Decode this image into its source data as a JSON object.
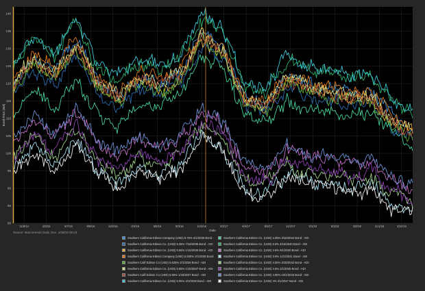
{
  "chart_data": {
    "type": "line",
    "title": "",
    "xlabel": "Date",
    "ylabel": "Bond Price (Bid)",
    "ylim": [
      80,
      142
    ],
    "yticks": [
      80,
      85,
      90,
      95,
      100,
      105,
      110,
      115,
      120,
      125,
      130,
      135,
      140
    ],
    "x_tick_labels": [
      "11/6/14",
      "2/3/15",
      "5/7/15",
      "8/6/15",
      "11/5/15",
      "2/4/16",
      "5/5/16",
      "8/4/16",
      "11/3/16",
      "2/2/17",
      "5/4/17",
      "8/3/17",
      "11/2/17",
      "2/1/18",
      "5/3/18",
      "8/2/18",
      "11/1/18",
      "1/31/19"
    ],
    "grid": true,
    "legend_position": "bottom",
    "source": "Source: Macrotrends Daily. Dec. 4/28/19 09:23",
    "series": [
      {
        "name": "Southern California Edison Company (USD) 5.75% 4/1/2035 Bond - ADI",
        "color": "#3d8fd6",
        "values": [
          120,
          128,
          124,
          133,
          121,
          117,
          121,
          119,
          123,
          135,
          130,
          116,
          114,
          122,
          120,
          118,
          118,
          118,
          111,
          106
        ]
      },
      {
        "name": "Southern California Edison Co. (USD) 4.05% 3/15/2042 Bond - ADI",
        "color": "#46d49a",
        "values": [
          111,
          118,
          112,
          121,
          112,
          108,
          114,
          113,
          118,
          128,
          124,
          111,
          109,
          116,
          113,
          112,
          111,
          112,
          106,
          102
        ]
      },
      {
        "name": "Southern California Edison Co. (USD) 5.35% 7/15/2035 Bond - ADI",
        "color": "#2a6bb0",
        "values": [
          117,
          124,
          119,
          128,
          117,
          113,
          118,
          116,
          121,
          131,
          127,
          114,
          112,
          119,
          117,
          115,
          114,
          115,
          108,
          104
        ]
      },
      {
        "name": "Southern California Edison Co. (USD) 5.5% 3/15/2040 Bond - ADI",
        "color": "#2fb26b",
        "values": [
          124,
          133,
          128,
          138,
          124,
          121,
          126,
          124,
          128,
          138,
          135,
          119,
          117,
          127,
          124,
          123,
          122,
          122,
          115,
          111
        ]
      },
      {
        "name": "Southern California Edison Co. (USD) 5.55% 1/15/2036 Bond - ADI",
        "color": "#e8b13a",
        "values": [
          119,
          127,
          122,
          131,
          120,
          116,
          121,
          118,
          122,
          133,
          129,
          115,
          113,
          121,
          119,
          117,
          116,
          116,
          109,
          105
        ]
      },
      {
        "name": "Southern California Edison Co. (USD) 4.5% 9/1/2040 Bond - ADI",
        "color": "#c070c8",
        "values": [
          103,
          110,
          104,
          112,
          103,
          99,
          104,
          101,
          104,
          112,
          108,
          96,
          94,
          101,
          99,
          98,
          97,
          98,
          92,
          90
        ]
      },
      {
        "name": "Southern California Edison Company (USD) 5.625% 2/1/2036 Bond - ADI",
        "color": "#e07b1a",
        "values": [
          121,
          129,
          124,
          133,
          122,
          118,
          123,
          121,
          125,
          135,
          131,
          117,
          115,
          123,
          121,
          119,
          118,
          118,
          111,
          107
        ]
      },
      {
        "name": "Southern California Edison Co. (USD) 3.9% 12/1/2041 Bond - ADI",
        "color": "#a9e0f0",
        "values": [
          95,
          102,
          96,
          104,
          95,
          91,
          96,
          94,
          97,
          105,
          101,
          89,
          88,
          94,
          92,
          91,
          90,
          91,
          85,
          84
        ]
      },
      {
        "name": "Southern Calif Edison Co (USD) 5.625% 2/1/2036 Bond - ADI",
        "color": "#5fae3b",
        "values": [
          118,
          126,
          121,
          130,
          119,
          115,
          120,
          117,
          121,
          132,
          128,
          114,
          112,
          120,
          118,
          116,
          115,
          115,
          108,
          105
        ]
      },
      {
        "name": "Southern California Edison Co. (USD) 4.05% 3/15/2042 Bond - ADI",
        "color": "#9fd08a",
        "values": [
          98,
          105,
          99,
          107,
          98,
          94,
          99,
          97,
          100,
          108,
          104,
          92,
          91,
          97,
          95,
          94,
          93,
          94,
          88,
          86
        ]
      },
      {
        "name": "Southern California Edison Co. (USD) 5.55% 1/15/2037 Bond - ADI",
        "color": "#d2dd8a",
        "values": [
          120,
          128,
          123,
          132,
          121,
          117,
          122,
          120,
          124,
          134,
          130,
          116,
          114,
          122,
          120,
          118,
          117,
          117,
          110,
          106
        ]
      },
      {
        "name": "Southern California Edison Co. (USD) 3.6% 2/1/2045 Bond - ADI",
        "color": "#8a3fae",
        "values": [
          99,
          106,
          100,
          108,
          99,
          95,
          100,
          98,
          101,
          109,
          105,
          93,
          92,
          98,
          96,
          95,
          94,
          95,
          89,
          87
        ]
      },
      {
        "name": "Southern Calif Edison Co (USD) 5.55% 1/15/2037 Bond - ADI",
        "color": "#a54a3a",
        "values": [
          119,
          127,
          122,
          131,
          120,
          116,
          121,
          119,
          123,
          133,
          129,
          115,
          113,
          121,
          119,
          117,
          116,
          116,
          109,
          105
        ]
      },
      {
        "name": "Southern California Edison Co. (USD) 4.65% 10/1/2043 Bond - ADI",
        "color": "#6a8fd0",
        "values": [
          104,
          111,
          105,
          113,
          104,
          100,
          105,
          102,
          105,
          113,
          109,
          97,
          95,
          102,
          100,
          99,
          98,
          99,
          93,
          91
        ]
      },
      {
        "name": "Southern California Edison Co. (USD) 5.95% 2/1/2038 Bond - ADI",
        "color": "#3ec7d6",
        "values": [
          125,
          134,
          129,
          139,
          125,
          122,
          127,
          125,
          129,
          140,
          136,
          120,
          118,
          128,
          125,
          124,
          123,
          123,
          116,
          112
        ]
      },
      {
        "name": "Southern California Edison Co. (USD) 4% 4/1/2047 Bond - ADI",
        "color": "#f2f2f2",
        "values": [
          94,
          100,
          95,
          103,
          94,
          90,
          95,
          93,
          96,
          104,
          100,
          88,
          87,
          93,
          91,
          90,
          89,
          90,
          84,
          83
        ]
      }
    ]
  }
}
